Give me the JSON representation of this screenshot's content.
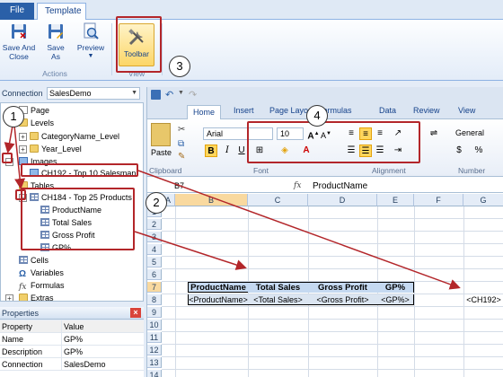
{
  "ribbon": {
    "tabs": [
      {
        "label": "File"
      },
      {
        "label": "Template"
      }
    ],
    "buttons": {
      "save_and_close": "Save And\nClose",
      "save_as": "Save\nAs",
      "preview": "Preview",
      "toolbar": "Toolbar"
    },
    "groups": {
      "actions": "Actions",
      "view": "View"
    }
  },
  "connection": {
    "label": "Connection",
    "value": "SalesDemo"
  },
  "tree": {
    "page": "Page",
    "levels": "Levels",
    "category_level": "CategoryName_Level",
    "year_level": "Year_Level",
    "images": "Images",
    "image_item": "CH192 - Top 10 Salesman",
    "tables": "Tables",
    "table_item": "CH184 - Top 25 Products",
    "fields": [
      "ProductName",
      "Total Sales",
      "Gross Profit",
      "GP%"
    ],
    "cells": "Cells",
    "variables": "Variables",
    "formulas": "Formulas",
    "extras": "Extras"
  },
  "properties": {
    "title": "Properties",
    "header": {
      "property": "Property",
      "value": "Value"
    },
    "rows": [
      {
        "property": "Name",
        "value": "GP%"
      },
      {
        "property": "Description",
        "value": "GP%"
      },
      {
        "property": "Connection",
        "value": "SalesDemo"
      }
    ]
  },
  "excel": {
    "tabs": [
      "Home",
      "Insert",
      "Page Layo",
      "Formulas",
      "Data",
      "Review",
      "View"
    ],
    "clipboard": {
      "paste": "Paste",
      "label": "Clipboard"
    },
    "font": {
      "name": "Arial",
      "size": "10",
      "label": "Font"
    },
    "alignment": {
      "label": "Alignment"
    },
    "number": {
      "format": "General",
      "label": "Number",
      "currency": "$",
      "percent": "%"
    },
    "name_box": "B7",
    "fx": "fx",
    "formula": "ProductName",
    "columns": [
      "A",
      "B",
      "C",
      "D",
      "E",
      "F",
      "G"
    ],
    "rows": [
      "1",
      "2",
      "3",
      "4",
      "5",
      "6",
      "7",
      "8",
      "9",
      "10",
      "11",
      "12",
      "13",
      "14"
    ],
    "table_headers": [
      "ProductName",
      "Total Sales",
      "Gross Profit",
      "GP%"
    ],
    "table_values": [
      "<ProductName>",
      "<Total Sales>",
      "<Gross Profit>",
      "<GP%>"
    ],
    "image_tag": "<CH192>"
  },
  "callouts": [
    "1",
    "2",
    "3",
    "4"
  ],
  "colors": {
    "highlight": "#b3262a",
    "ribbon_blue": "#2a60a8"
  }
}
